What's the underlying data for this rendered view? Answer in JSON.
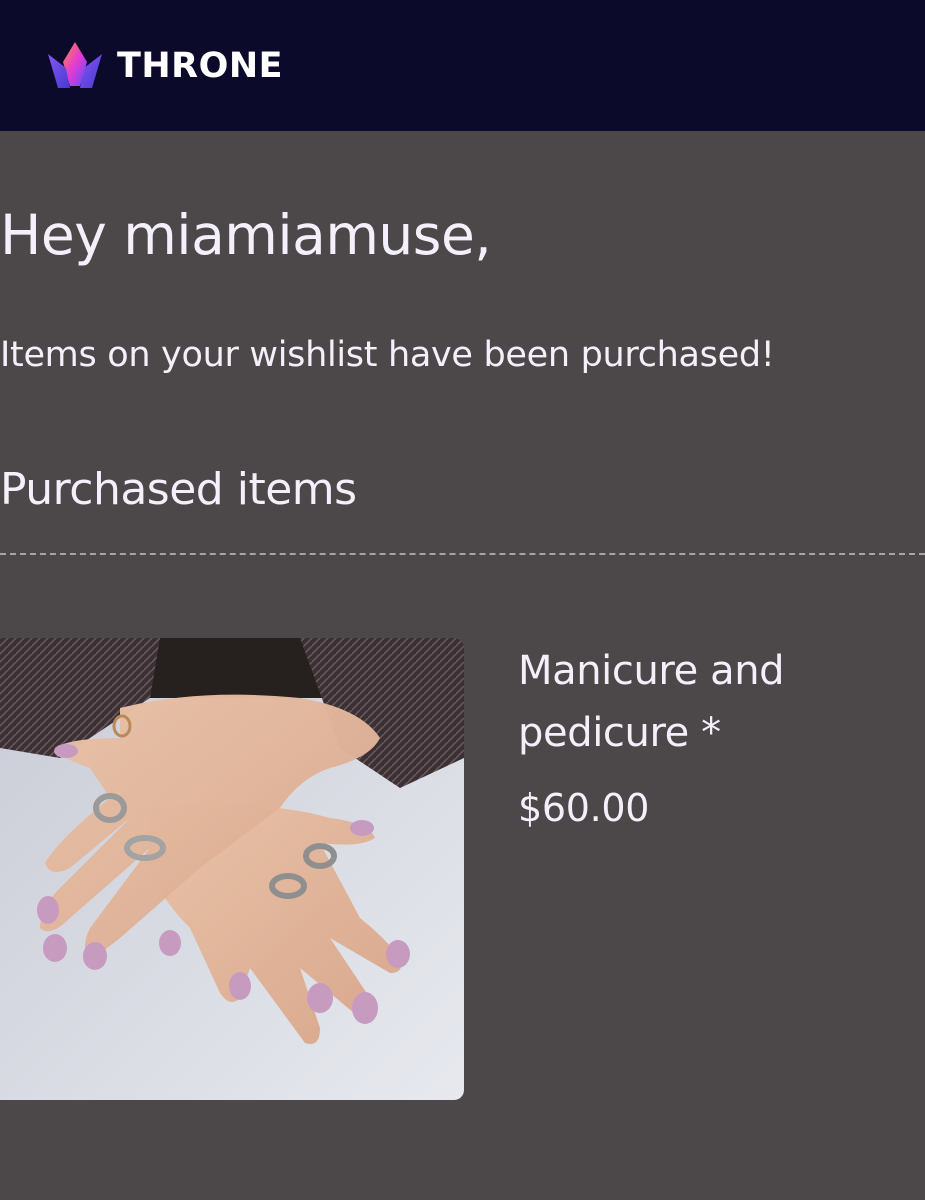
{
  "header": {
    "logo_icon": "crown-icon",
    "brand": "THRONE",
    "background": "#0b0a2a"
  },
  "email": {
    "greeting": "Hey miamiamuse,",
    "message": "Items on your wishlist have been purchased!",
    "section_title": "Purchased items"
  },
  "items": [
    {
      "image": "manicured-hands-photo",
      "name": "Manicure and pedicure *",
      "price": "$60.00"
    }
  ],
  "colors": {
    "background": "#4c4849",
    "text": "#f4f0fb",
    "crown_gradient": [
      "#ff7a3d",
      "#e03bd6",
      "#6a4bff"
    ]
  }
}
